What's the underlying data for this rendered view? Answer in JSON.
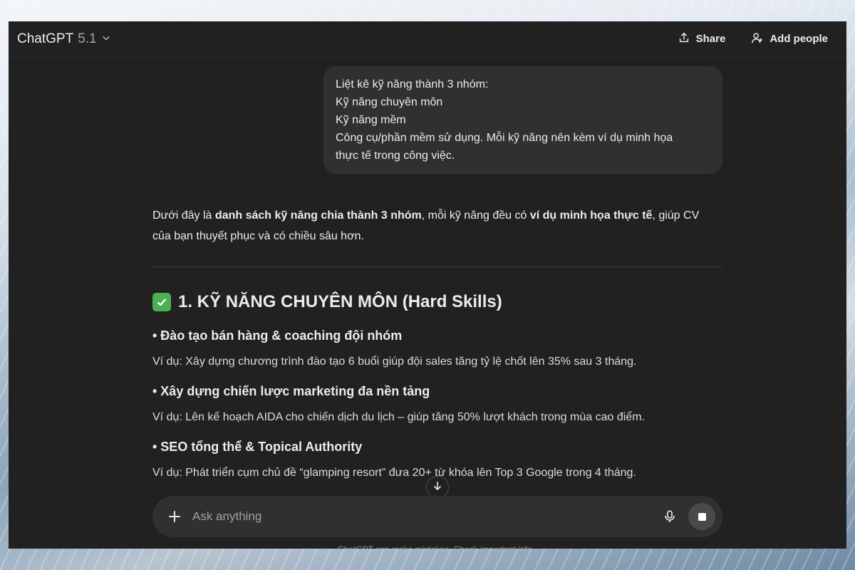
{
  "header": {
    "model_name": "ChatGPT",
    "model_version": "5.1",
    "share_label": "Share",
    "add_people_label": "Add people"
  },
  "user_message": {
    "lines": [
      "Liệt kê kỹ năng thành 3 nhóm:",
      "Kỹ năng chuyên môn",
      "Kỹ năng mềm",
      "Công cụ/phần mềm sử dụng. Mỗi kỹ năng nên kèm ví dụ minh họa",
      "thực tế trong công việc."
    ]
  },
  "assistant": {
    "intro": {
      "p1": "Dưới đây là ",
      "b1": "danh sách kỹ năng chia thành 3 nhóm",
      "p2": ", mỗi kỹ năng đều có ",
      "b2": "ví dụ minh họa thực tế",
      "p3": ", giúp CV",
      "p4": "của bạn thuyết phục và có chiều sâu hơn."
    },
    "section_title": "1. KỸ NĂNG CHUYÊN MÔN (Hard Skills)",
    "skills": [
      {
        "title": "• Đào tạo bán hàng & coaching đội nhóm",
        "example": "Ví dụ: Xây dựng chương trình đào tạo 6 buổi giúp đội sales tăng tỷ lệ chốt lên 35% sau 3 tháng."
      },
      {
        "title": "• Xây dựng chiến lược marketing đa nền tảng",
        "example": "Ví dụ: Lên kế hoạch AIDA cho chiến dịch du lịch – giúp tăng 50% lượt khách trong mùa cao điểm."
      },
      {
        "title": "• SEO tổng thể & Topical Authority",
        "example": "Ví dụ: Phát triển cụm chủ đề “glamping resort” đưa 20+ từ khóa lên Top 3 Google trong 4 tháng."
      }
    ]
  },
  "composer": {
    "placeholder": "Ask anything"
  },
  "footer": {
    "note": "ChatGPT can make mistakes. Check important info."
  },
  "icons": {
    "chevron": "chevron-down-icon",
    "share": "share-icon",
    "add_people": "add-person-icon",
    "check": "check-box-icon",
    "scroll": "arrow-down-icon",
    "plus": "plus-icon",
    "mic": "microphone-icon",
    "stop": "stop-icon"
  },
  "colors": {
    "background": "#212121",
    "bubble": "#303030",
    "text": "#ececec",
    "check_green": "#4caf50"
  }
}
